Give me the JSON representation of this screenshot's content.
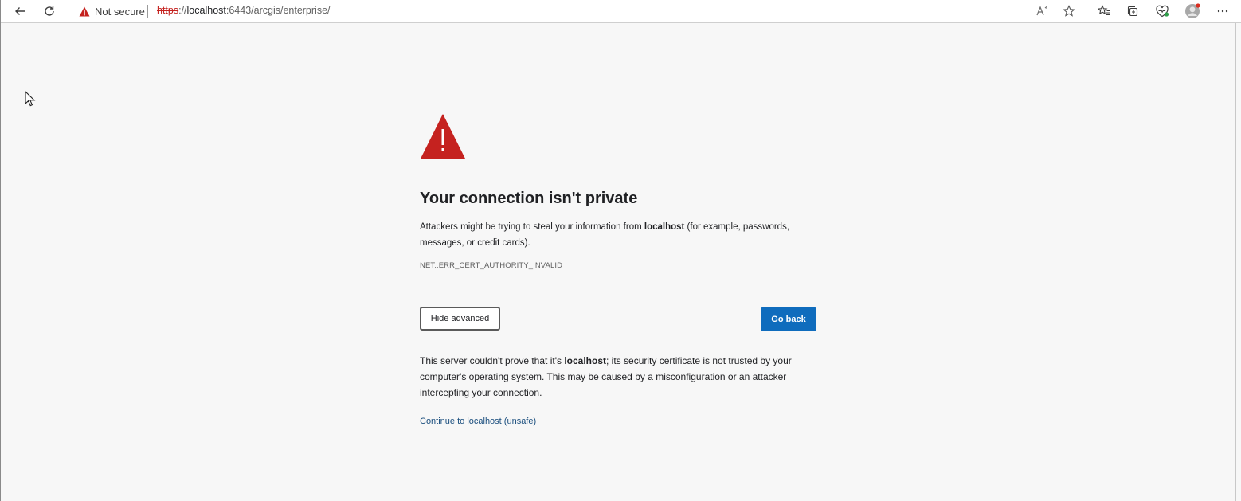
{
  "browser": {
    "security_label": "Not secure",
    "url": {
      "scheme": "https",
      "rest_prefix": "://",
      "host": "localhost",
      "path": ":6443/arcgis/enterprise/"
    },
    "icons": {
      "back": "back-arrow-icon",
      "reload": "reload-icon",
      "warning": "warning-triangle-icon",
      "read_aloud": "read-aloud-icon",
      "favorite": "star-icon",
      "favorites": "favorites-list-icon",
      "collections": "collections-icon",
      "extensions": "browser-essentials-icon",
      "profile": "profile-avatar-icon",
      "menu": "more-menu-icon"
    },
    "colors": {
      "warning_red": "#c5221f",
      "accent_blue": "#0f6cbd"
    }
  },
  "page": {
    "title": "Your connection isn't private",
    "desc_prefix": "Attackers might be trying to steal your information from ",
    "desc_host": "localhost",
    "desc_suffix": " (for example, passwords, messages, or credit cards).",
    "error_code": "NET::ERR_CERT_AUTHORITY_INVALID",
    "advanced_button": "Hide advanced",
    "back_button": "Go back",
    "details_prefix": "This server couldn't prove that it's ",
    "details_host": "localhost",
    "details_suffix": "; its security certificate is not trusted by your computer's operating system. This may be caused by a misconfiguration or an attacker intercepting your connection.",
    "proceed_link": "Continue to localhost (unsafe)"
  }
}
